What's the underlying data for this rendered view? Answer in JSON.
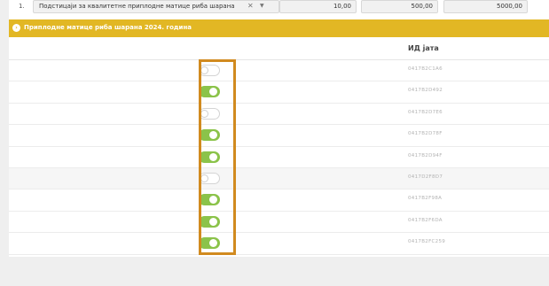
{
  "top_row": {
    "row_number": "1.",
    "select_text": "Подстицаји за квалитетне приплодне матице риба шарана",
    "clear_icon": "close-icon",
    "arrow_icon": "chevron-down-icon",
    "values": [
      "10,00",
      "500,00",
      "5000,00"
    ]
  },
  "section": {
    "icon": "chevron-right-icon",
    "title": "Приплодне матице риба шарана 2024. година"
  },
  "table": {
    "column_header": "ИД јата",
    "rows": [
      {
        "id": "0417B2C1A6",
        "checked": false
      },
      {
        "id": "0417B2D492",
        "checked": true
      },
      {
        "id": "0417B2D7E6",
        "checked": false
      },
      {
        "id": "0417B2D78F",
        "checked": true
      },
      {
        "id": "0417B2D94F",
        "checked": true
      },
      {
        "id": "0417D2F8D7",
        "checked": false
      },
      {
        "id": "0417B2F98A",
        "checked": true
      },
      {
        "id": "0417B2F6DA",
        "checked": true
      },
      {
        "id": "0417B2FC259",
        "checked": true
      }
    ]
  },
  "colors": {
    "header_bg": "#e2b724",
    "toggle_on": "#8bc34a",
    "highlight": "#d18a1f"
  }
}
